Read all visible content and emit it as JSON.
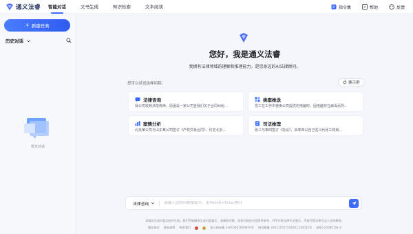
{
  "app": {
    "name": "通义法睿"
  },
  "nav": [
    "智能对话",
    "文书生成",
    "知识检索",
    "文本阅读"
  ],
  "top_right": [
    "指令集",
    "帮助",
    "反馈"
  ],
  "sidebar": {
    "new_task": "新建任务",
    "history_label": "历史对话",
    "empty_text": "暂无对话",
    "collapse_glyph": "«|"
  },
  "hero": {
    "title": "您好，我是通义法睿",
    "subtitle": "我拥有法律领域的理解和推理能力，是您身边的AI法律顾问。"
  },
  "examples": {
    "label": "您可以试试这样问我：",
    "switch_label": "换示例",
    "cards": [
      {
        "title": "法律咨询",
        "desc": "我公司收到法院传唤，原因是一家公司告我们关于合同纠纷...",
        "icon": "legal-consult-icon",
        "color": "#3b6cff"
      },
      {
        "title": "类案推送",
        "desc": "员工在工作中使用公司提供的电脑时，因电脑存在病毒而导...",
        "icon": "case-push-icon",
        "color": "#3b6cff"
      },
      {
        "title": "案情分析",
        "desc": "北京某公司与山东某公司签订《产权交易合同》，约定北京...",
        "icon": "case-analysis-icon",
        "color": "#3b6cff"
      },
      {
        "title": "司法推理",
        "desc": "张三与李四签订《协议》，由李四以自己名义代张三购房...",
        "icon": "judicial-reasoning-icon",
        "color": "#3b6cff"
      }
    ]
  },
  "input": {
    "mode": "法律咨询",
    "placeholder": "请输入您的问题或指令，支持shift+Enter换行"
  },
  "footer": {
    "line1": "本服务生成内容均由AI生成，我们不能确保生成内容真实、准确和完整，相关内容仅为您提供参考，并不代表法律专业意见，不能代替法律专业人员的解答。",
    "links": [
      "服务协议",
      "隐私政策",
      "联系我们"
    ],
    "reg1": "浙公网安备 33010602009870号",
    "reg2": "网信算备 330110507206401230035号",
    "reg3": "浙B2-20080101-4"
  },
  "colors": {
    "accent": "#3b6cff",
    "background": "#f4f6fb"
  }
}
